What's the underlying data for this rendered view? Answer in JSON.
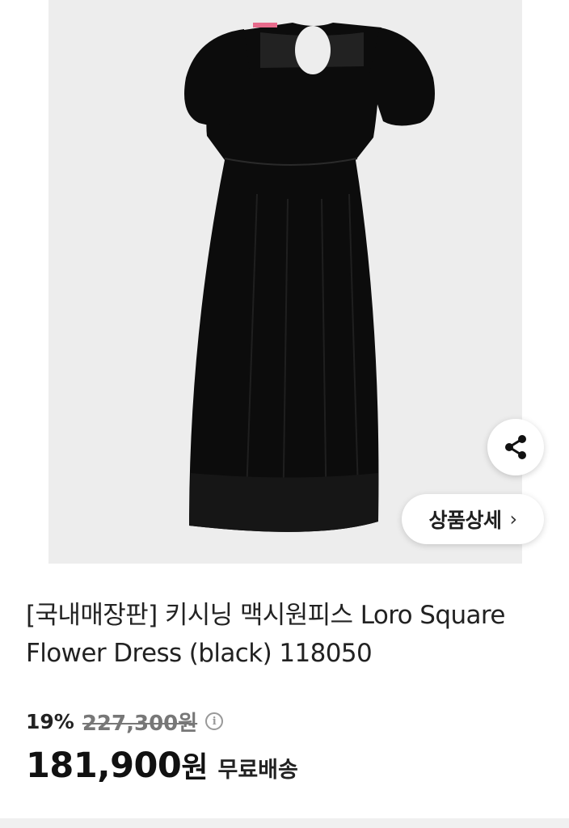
{
  "product": {
    "image_alt": "black maxi dress",
    "title": "[국내매장판] 키시닝 맥시원피스 Loro Square Flower Dress (black) 118050",
    "discount_rate": "19%",
    "original_price": "227,300원",
    "sale_price": "181,900",
    "sale_price_unit": "원",
    "shipping": "무료배송"
  },
  "actions": {
    "share_icon": "share-icon",
    "detail_label": "상품상세",
    "detail_chevron": "›"
  },
  "colors": {
    "image_background": "#ededed",
    "dress": "#0c0c0c",
    "text_primary": "#111111",
    "text_muted": "#777777"
  }
}
